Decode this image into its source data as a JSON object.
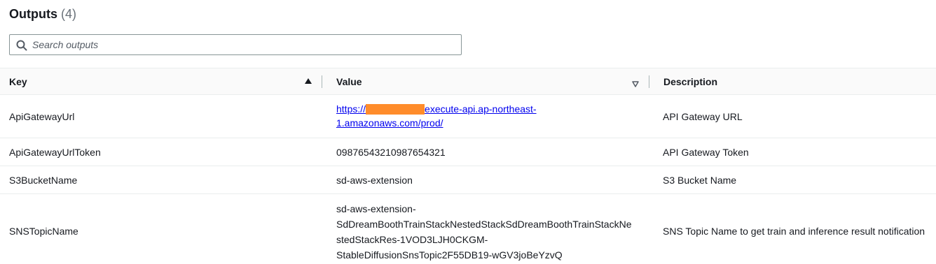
{
  "header": {
    "title": "Outputs",
    "count": "(4)"
  },
  "search": {
    "placeholder": "Search outputs",
    "value": ""
  },
  "columns": {
    "key": "Key",
    "value": "Value",
    "description": "Description"
  },
  "rows": [
    {
      "key": "ApiGatewayUrl",
      "value_prefix": "https://",
      "value_suffix_line1": "execute-api.ap-northeast-",
      "value_line2": "1.amazonaws.com/prod/",
      "description": "API Gateway URL"
    },
    {
      "key": "ApiGatewayUrlToken",
      "value": "09876543210987654321",
      "description": "API Gateway Token"
    },
    {
      "key": "S3BucketName",
      "value": "sd-aws-extension",
      "description": "S3 Bucket Name"
    },
    {
      "key": "SNSTopicName",
      "value_lines": [
        "sd-aws-extension-",
        "SdDreamBoothTrainStackNestedStackSdDreamBoothTrainStackNe",
        "stedStackRes-1VOD3LJH0CKGM-",
        "StableDiffusionSnsTopic2F55DB19-wGV3joBeYzvQ"
      ],
      "description": "SNS Topic Name to get train and inference result notification"
    }
  ],
  "colors": {
    "redaction": "#ff8c2b",
    "link": "#0000ee"
  }
}
